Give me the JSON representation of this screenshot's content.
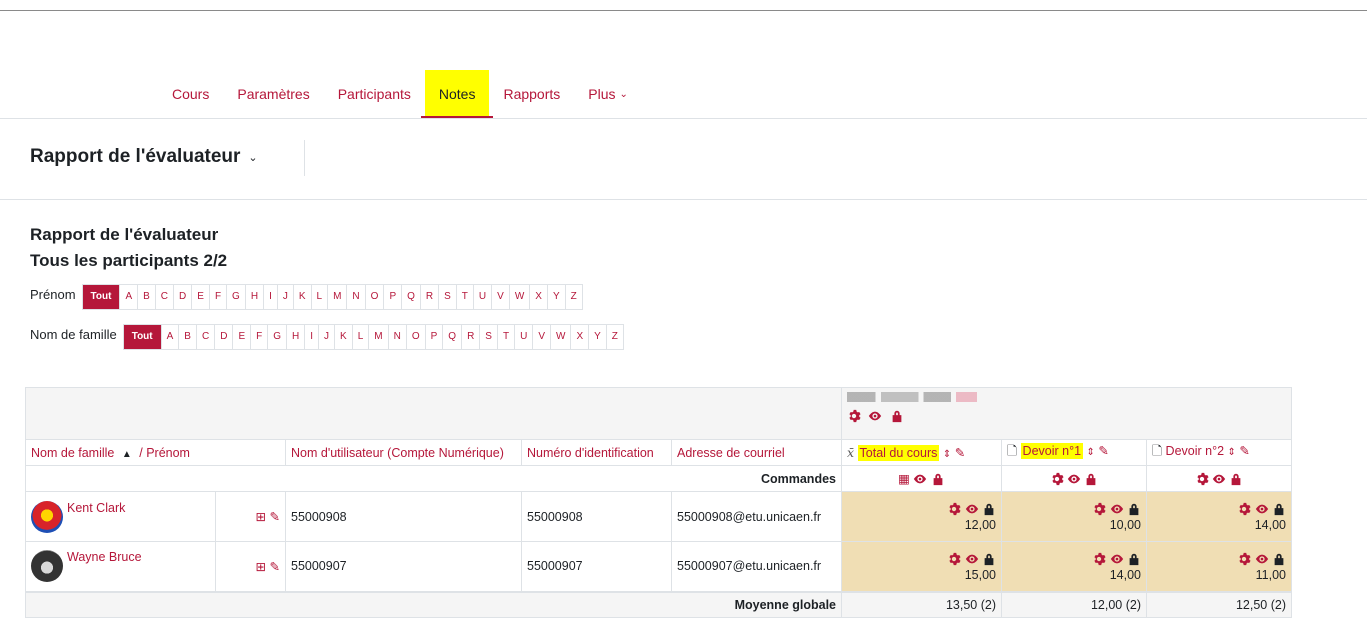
{
  "nav": {
    "items": [
      {
        "label": "Cours"
      },
      {
        "label": "Paramètres"
      },
      {
        "label": "Participants"
      },
      {
        "label": "Notes"
      },
      {
        "label": "Rapports"
      },
      {
        "label": "Plus"
      }
    ],
    "active": "Notes"
  },
  "report_selector": {
    "label": "Rapport de l'évaluateur"
  },
  "page": {
    "heading": "Rapport de l'évaluateur",
    "subheading": "Tous les participants 2/2"
  },
  "filters": {
    "firstname_label": "Prénom",
    "lastname_label": "Nom de famille",
    "all_label": "Tout",
    "letters": [
      "A",
      "B",
      "C",
      "D",
      "E",
      "F",
      "G",
      "H",
      "I",
      "J",
      "K",
      "L",
      "M",
      "N",
      "O",
      "P",
      "Q",
      "R",
      "S",
      "T",
      "U",
      "V",
      "W",
      "X",
      "Y",
      "Z"
    ]
  },
  "table": {
    "headers": {
      "lastname": "Nom de famille",
      "firstname": "/ Prénom",
      "username": "Nom d'utilisateur (Compte Numérique)",
      "idnumber": "Numéro d'identification",
      "email": "Adresse de courriel",
      "total": "Total du cours",
      "devoir1": "Devoir n°1",
      "devoir2": "Devoir n°2"
    },
    "commands_label": "Commandes",
    "rows": [
      {
        "name": "Kent Clark",
        "username": "55000908",
        "idnumber": "55000908",
        "email": "55000908@etu.unicaen.fr",
        "total": "12,00",
        "devoir1": "10,00",
        "devoir2": "14,00"
      },
      {
        "name": "Wayne Bruce",
        "username": "55000907",
        "idnumber": "55000907",
        "email": "55000907@etu.unicaen.fr",
        "total": "15,00",
        "devoir1": "14,00",
        "devoir2": "11,00"
      }
    ],
    "average_label": "Moyenne globale",
    "averages": {
      "total": "13,50 (2)",
      "devoir1": "12,00 (2)",
      "devoir2": "12,50 (2)"
    }
  },
  "colors": {
    "accent": "#b5173a",
    "highlight": "#ffff00",
    "grade_bg": "#f0deb4"
  }
}
